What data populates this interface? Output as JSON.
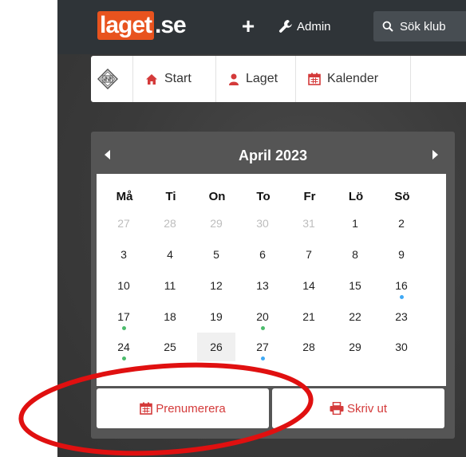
{
  "topbar": {
    "logo_brand": "laget",
    "logo_tld": ".se",
    "add_label": "+",
    "admin_label": "Admin",
    "search_placeholder": "Sök klub"
  },
  "nav": {
    "items": [
      {
        "label": "Start",
        "icon": "home-icon"
      },
      {
        "label": "Laget",
        "icon": "user-icon"
      },
      {
        "label": "Kalender",
        "icon": "calendar-icon"
      }
    ]
  },
  "calendar": {
    "title": "April 2023",
    "weekdays": [
      "Må",
      "Ti",
      "On",
      "To",
      "Fr",
      "Lö",
      "Sö"
    ],
    "weeks": [
      [
        "27",
        "28",
        "29",
        "30",
        "31",
        "1",
        "2"
      ],
      [
        "3",
        "4",
        "5",
        "6",
        "7",
        "8",
        "9"
      ],
      [
        "10",
        "11",
        "12",
        "13",
        "14",
        "15",
        "16"
      ],
      [
        "17",
        "18",
        "19",
        "20",
        "21",
        "22",
        "23"
      ],
      [
        "24",
        "25",
        "26",
        "27",
        "28",
        "29",
        "30"
      ]
    ],
    "muted_days_first_week": 5,
    "today": "26",
    "event_dots": [
      {
        "day": "16",
        "color": "#3fa9f5"
      },
      {
        "day": "17",
        "color": "#4cbb6c"
      },
      {
        "day": "20",
        "color": "#4cbb6c"
      },
      {
        "day": "24",
        "color": "#4cbb6c"
      },
      {
        "day": "27",
        "color": "#3fa9f5"
      }
    ]
  },
  "actions": {
    "subscribe_label": "Prenumerera",
    "print_label": "Skriv ut"
  },
  "colors": {
    "brand": "#e8531e",
    "accent_red": "#d43a3a",
    "annotation_red": "#e01010"
  }
}
